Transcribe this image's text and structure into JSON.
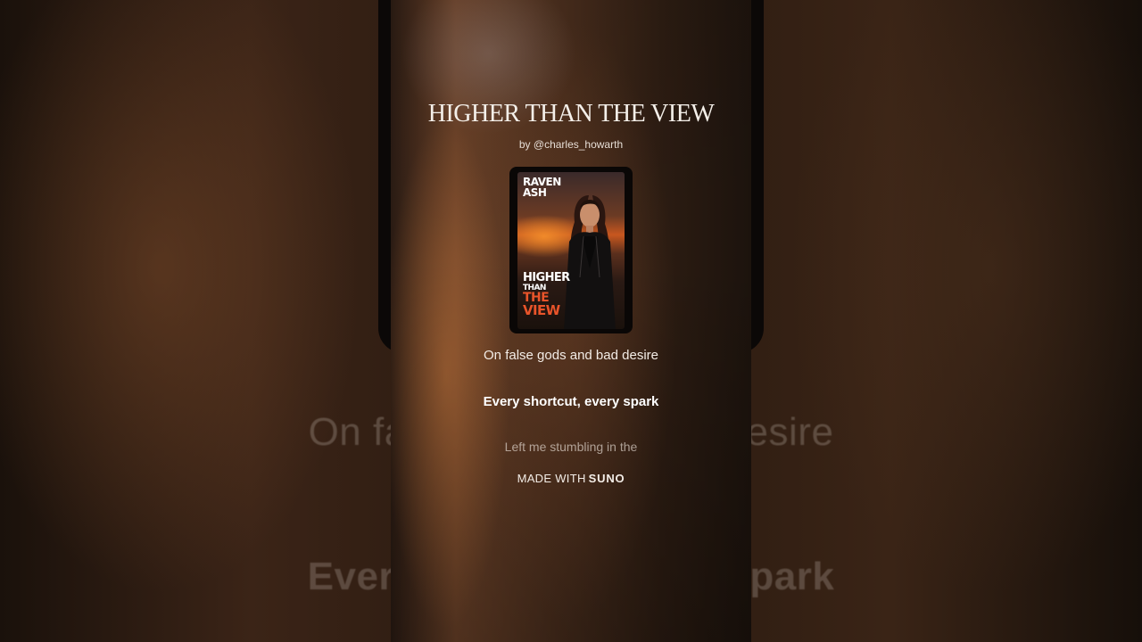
{
  "background": {
    "lyric_echo_1": "On false gods and bad desire",
    "lyric_echo_2": "Every shortcut, every spark"
  },
  "song": {
    "title": "HIGHER THAN THE VIEW",
    "artist": "by @charles_howarth"
  },
  "cover": {
    "artist_line_1": "RAVEN",
    "artist_line_2": "ASH",
    "title_line_1": "HIGHER",
    "title_line_2": "THAN",
    "title_line_3": "THE",
    "title_line_4": "VIEW"
  },
  "lyrics": {
    "previous": "On false gods and bad desire",
    "current": "Every shortcut, every spark",
    "next": "Left me stumbling in the"
  },
  "footer": {
    "made_with": "MADE WITH",
    "brand": "SUNO"
  },
  "colors": {
    "accent_orange": "#e8542a",
    "text_primary": "#f3ece6"
  }
}
